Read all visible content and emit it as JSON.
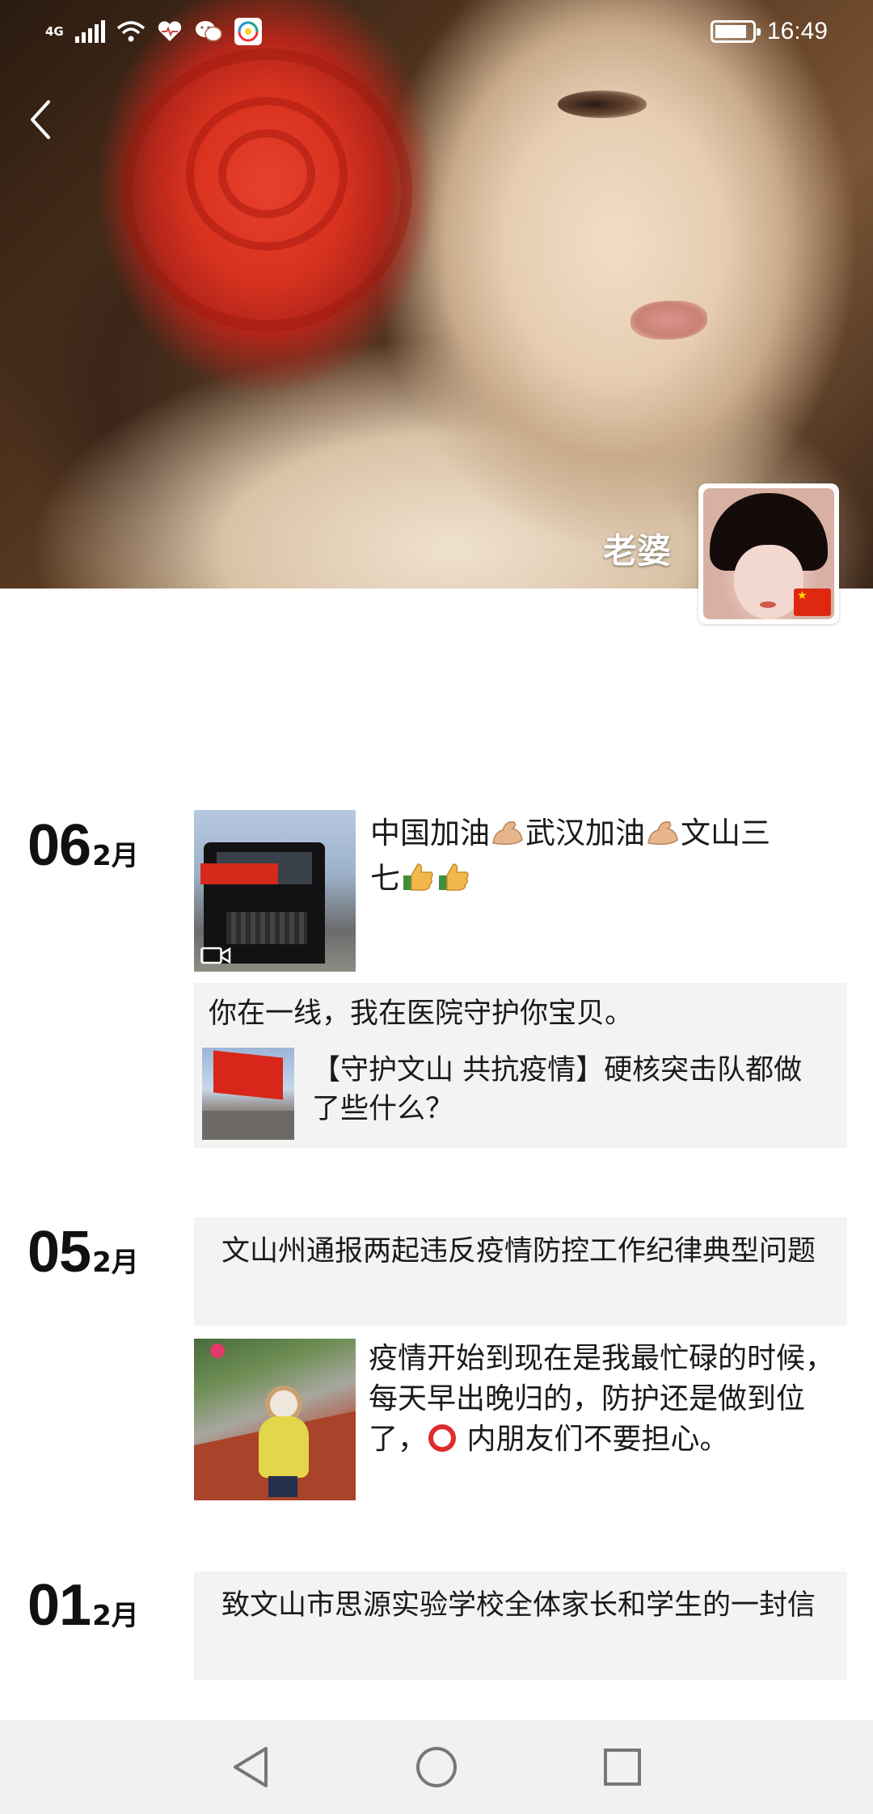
{
  "status_bar": {
    "network": "4G",
    "time": "16:49",
    "battery_percent": 80,
    "icons": [
      "signal-icon",
      "wifi-icon",
      "health-icon",
      "wechat-icon",
      "app-icon",
      "battery-icon"
    ]
  },
  "profile": {
    "nickname": "老婆"
  },
  "posts": [
    {
      "day": "06",
      "month": "2月",
      "text": "中国加油💪武汉加油💪文山三七👍👍",
      "text_parts": [
        "中国加油",
        "武汉加油",
        "文山三",
        "七"
      ],
      "card_title": "你在一线，我在医院守护你宝贝。",
      "card_link_text": "【守护文山 共抗疫情】硬核突击队都做了些什么？"
    },
    {
      "day": "05",
      "month": "2月",
      "card_text": "文山州通报两起违反疫情防控工作纪律典型问题",
      "text_before": "疫情开始到现在是我最忙碌的时候，每天早出晚归的，防护还是做到位了，",
      "text_after": " 内朋友们不要担心。"
    },
    {
      "day": "01",
      "month": "2月",
      "card_text": "致文山市思源实验学校全体家长和学生的一封信"
    }
  ],
  "colors": {
    "card_bg": "#f3f3f3",
    "nav_bg": "#f1f1f1",
    "ring_red": "#e12b2b"
  }
}
